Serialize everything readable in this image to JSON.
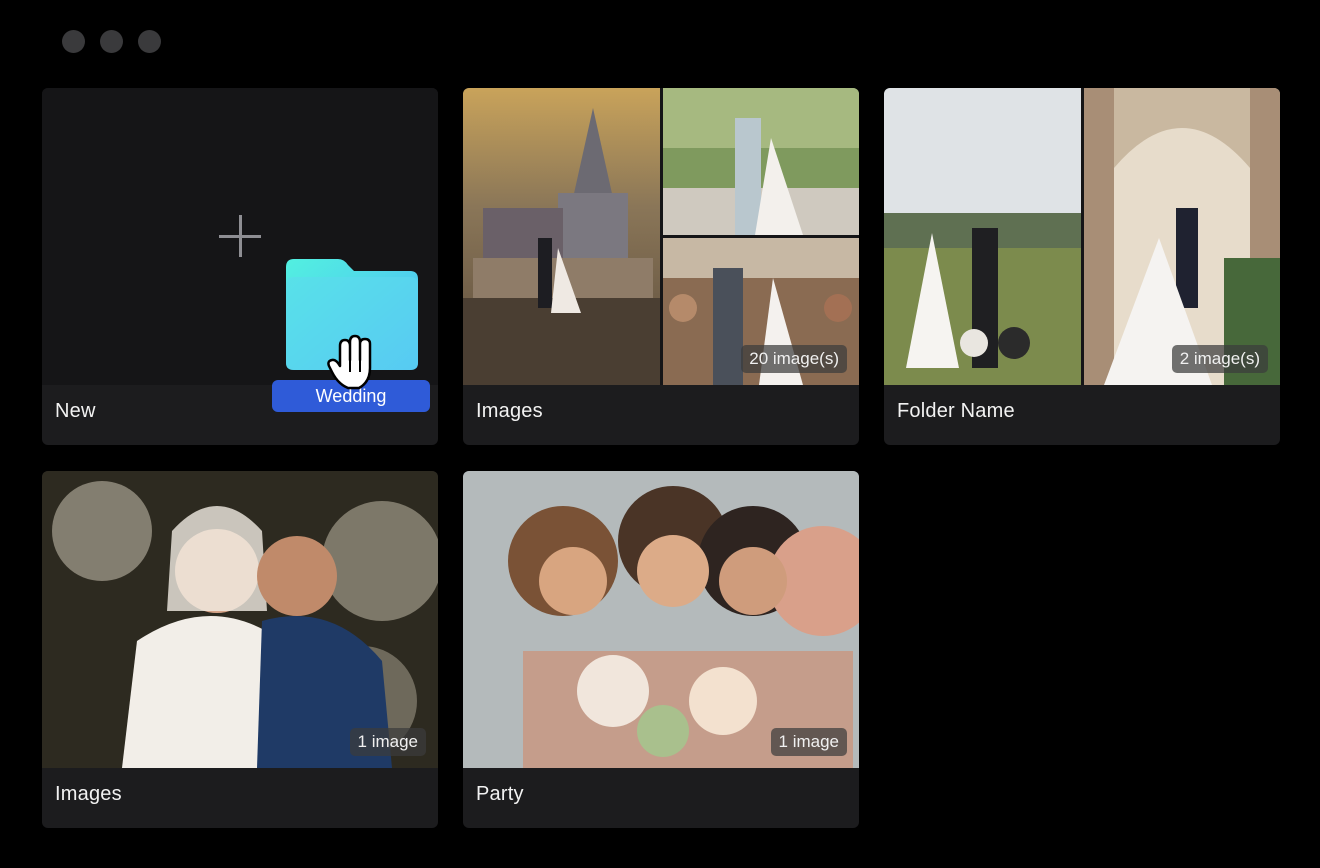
{
  "window": {
    "controls": [
      "close-dot",
      "minimize-dot",
      "maximize-dot"
    ]
  },
  "cards": [
    {
      "label": "New"
    },
    {
      "label": "Images",
      "count": "20 image(s)"
    },
    {
      "label": "Folder Name",
      "count": "2 image(s)"
    },
    {
      "label": "Images",
      "count": "1 image"
    },
    {
      "label": "Party",
      "count": "1 image"
    }
  ],
  "drag": {
    "folder_name": "Wedding",
    "icon": "folder-icon",
    "cursor": "hand-grab-cursor"
  },
  "colors": {
    "card_bg": "#1c1c1e",
    "drag_tag": "#2f5bd8",
    "folder_gradient_start": "#52f0e0",
    "folder_gradient_end": "#4fb8f7"
  }
}
